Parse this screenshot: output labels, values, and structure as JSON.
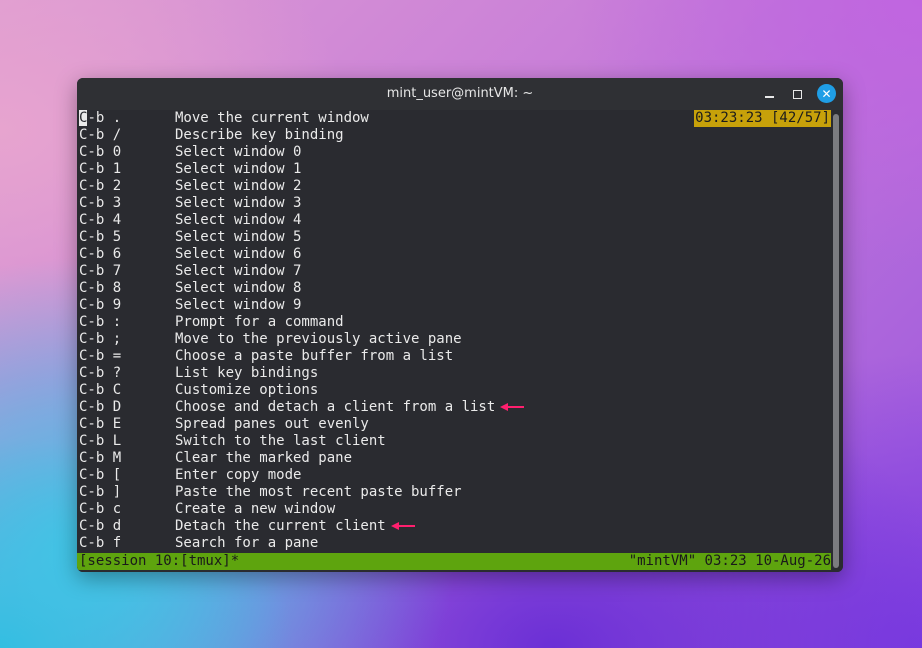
{
  "window": {
    "title": "mint_user@mintVM: ~"
  },
  "tmux": {
    "clock": "03:23:23 [42/57]",
    "lines": [
      {
        "key": "C-b .",
        "desc": "Move the current window"
      },
      {
        "key": "C-b /",
        "desc": "Describe key binding"
      },
      {
        "key": "C-b 0",
        "desc": "Select window 0"
      },
      {
        "key": "C-b 1",
        "desc": "Select window 1"
      },
      {
        "key": "C-b 2",
        "desc": "Select window 2"
      },
      {
        "key": "C-b 3",
        "desc": "Select window 3"
      },
      {
        "key": "C-b 4",
        "desc": "Select window 4"
      },
      {
        "key": "C-b 5",
        "desc": "Select window 5"
      },
      {
        "key": "C-b 6",
        "desc": "Select window 6"
      },
      {
        "key": "C-b 7",
        "desc": "Select window 7"
      },
      {
        "key": "C-b 8",
        "desc": "Select window 8"
      },
      {
        "key": "C-b 9",
        "desc": "Select window 9"
      },
      {
        "key": "C-b :",
        "desc": "Prompt for a command"
      },
      {
        "key": "C-b ;",
        "desc": "Move to the previously active pane"
      },
      {
        "key": "C-b =",
        "desc": "Choose a paste buffer from a list"
      },
      {
        "key": "C-b ?",
        "desc": "List key bindings"
      },
      {
        "key": "C-b C",
        "desc": "Customize options"
      },
      {
        "key": "C-b D",
        "desc": "Choose and detach a client from a list",
        "arrow": true
      },
      {
        "key": "C-b E",
        "desc": "Spread panes out evenly"
      },
      {
        "key": "C-b L",
        "desc": "Switch to the last client"
      },
      {
        "key": "C-b M",
        "desc": "Clear the marked pane"
      },
      {
        "key": "C-b [",
        "desc": "Enter copy mode"
      },
      {
        "key": "C-b ]",
        "desc": "Paste the most recent paste buffer"
      },
      {
        "key": "C-b c",
        "desc": "Create a new window"
      },
      {
        "key": "C-b d",
        "desc": "Detach the current client",
        "arrow": true
      },
      {
        "key": "C-b f",
        "desc": "Search for a pane"
      }
    ],
    "status_left": "[session 10:[tmux]*",
    "status_right": "\"mintVM\" 03:23 10-Aug-26"
  },
  "colors": {
    "clock_bg": "#c7a10a",
    "status_bg": "#5ea40e",
    "arrow": "#ff1f6e",
    "close_button": "#1f9ee6"
  }
}
